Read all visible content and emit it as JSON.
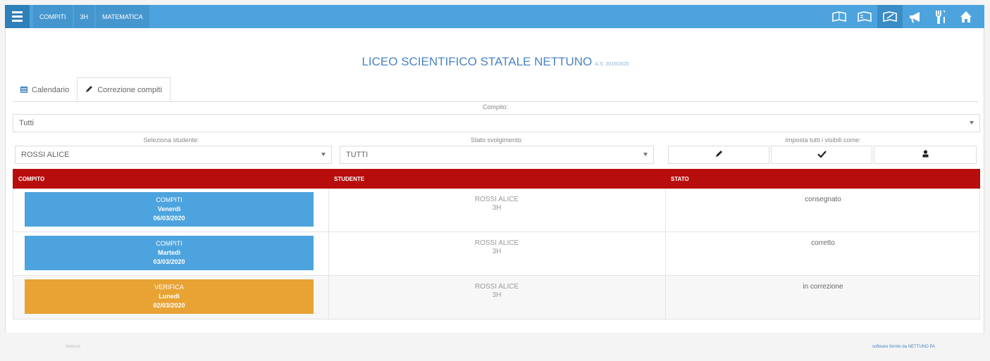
{
  "nav": {
    "breadcrumbs": [
      "COMPITI",
      "3H",
      "MATEMATICA"
    ]
  },
  "header": {
    "school": "LICEO SCIENTIFICO STATALE NETTUNO",
    "year": "A.S. 2019/2020"
  },
  "tabs": [
    {
      "label": "Calendario",
      "icon": "calendar-icon"
    },
    {
      "label": "Correzione compiti",
      "icon": "pencil-icon"
    }
  ],
  "filters": {
    "compito_label": "Compito:",
    "compito_value": "Tutti",
    "studente_label": "Seleziona studente:",
    "studente_value": "ROSSI ALICE",
    "stato_label": "Stato svolgimento:",
    "stato_value": "TUTTI",
    "imposta_label": "Imposta tutti i visibili come:"
  },
  "table": {
    "headers": [
      "COMPITO",
      "STUDENTE",
      "STATO"
    ],
    "rows": [
      {
        "type": "COMPITI",
        "day": "Venerdì",
        "date": "06/03/2020",
        "student": "ROSSI ALICE",
        "class": "3H",
        "status": "consegnato",
        "color": "#4da3dd"
      },
      {
        "type": "COMPITI",
        "day": "Martedì",
        "date": "03/03/2020",
        "student": "ROSSI ALICE",
        "class": "3H",
        "status": "corretto",
        "color": "#4da3dd"
      },
      {
        "type": "VERIFICA",
        "day": "Lunedì",
        "date": "02/03/2020",
        "student": "ROSSI ALICE",
        "class": "3H",
        "status": "in correzione",
        "color": "#e8a334"
      }
    ]
  },
  "footer": {
    "left": "Nettuno",
    "right": "software fornito da NETTUNO PA"
  }
}
